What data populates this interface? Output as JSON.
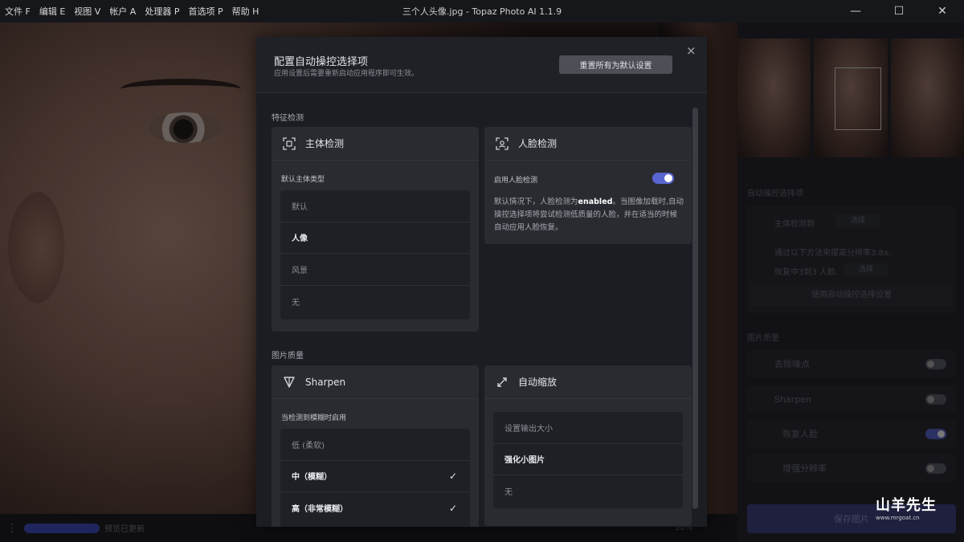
{
  "menu": [
    "文件 F",
    "编辑 E",
    "视图 V",
    "帐户 A",
    "处理器 P",
    "首选项 P",
    "帮助 H"
  ],
  "window_title": "三个人头像.jpg - Topaz Photo AI 1.1.9",
  "window_controls": {
    "minimize": "—",
    "maximize": "☐",
    "close": "✕"
  },
  "bottom_bar": {
    "preview_status": "预览已更新",
    "zoom": "50%"
  },
  "right_panel": {
    "autopilot_header": "自动操控选择项",
    "subject_row": "主体检测到",
    "subject_btn": "选择",
    "upscale_row": "通过以下方法来提高分辨率3.8x.",
    "restore_row": "恢复中3到3 人脸.",
    "restore_btn": "选择",
    "apply_autopilot": "使用自动操控选择设置",
    "quality_header": "图片质量",
    "rows": [
      {
        "label": "去除噪点",
        "on": false
      },
      {
        "label": "Sharpen",
        "on": false
      },
      {
        "label": "恢复人脸",
        "on": true
      },
      {
        "label": "增强分辨率",
        "on": false
      }
    ],
    "save_label": "保存图片"
  },
  "watermark": {
    "title": "山羊先生",
    "url": "www.mrgoat.cn"
  },
  "dialog": {
    "title": "配置自动操控选择项",
    "subtitle": "应用设置后需要重新启动应用程序即可生效。",
    "reset_label": "重置所有为默认设置",
    "close_label": "×",
    "section_detection": "特征检测",
    "subject_card": {
      "title": "主体检测",
      "label": "默认主体类型",
      "options": [
        {
          "label": "默认",
          "selected": false
        },
        {
          "label": "人像",
          "selected": true
        },
        {
          "label": "风景",
          "selected": false
        },
        {
          "label": "无",
          "selected": false
        }
      ]
    },
    "face_card": {
      "title": "人脸检测",
      "toggle_label": "启用人脸检测",
      "toggle_on": true,
      "desc_pre": "默认情况下，人脸检测为",
      "desc_bold": "enabled",
      "desc_post": "。当图像加载时,自动操控选择项将尝试检测低质量的人脸，并在适当的时候自动应用人脸恢复。"
    },
    "section_quality": "图片质量",
    "sharpen_card": {
      "title": "Sharpen",
      "label": "当检测到模糊时启用",
      "options": [
        {
          "label": "低 (柔软)",
          "selected": false,
          "checked": false
        },
        {
          "label": "中（模糊）",
          "selected": true,
          "checked": true
        },
        {
          "label": "高（非常模糊）",
          "selected": true,
          "checked": true
        }
      ],
      "check_glyph": "✓"
    },
    "upscale_card": {
      "title": "自动缩放",
      "options": [
        {
          "label": "设置输出大小",
          "selected": false
        },
        {
          "label": "强化小图片",
          "selected": true
        },
        {
          "label": "无",
          "selected": false
        }
      ]
    }
  },
  "colors": {
    "accent": "#5965d1",
    "dialog_bg": "#1c1d22",
    "card_bg": "#2a2b31"
  }
}
